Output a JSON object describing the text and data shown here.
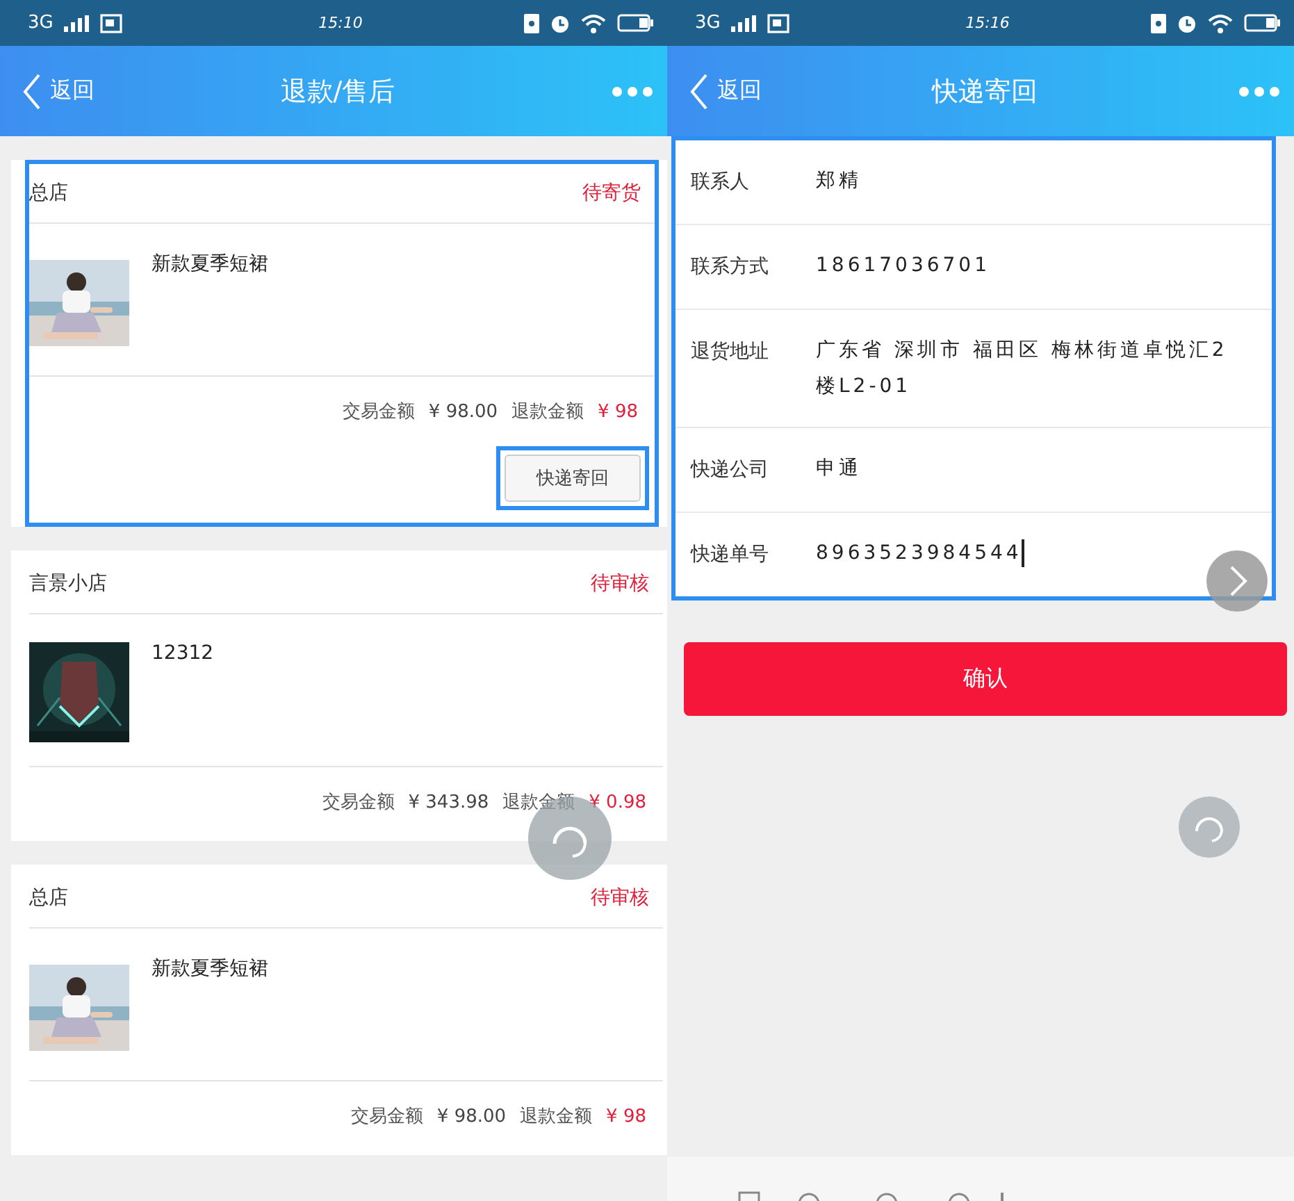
{
  "refund_list": {
    "status_bar": {
      "network": "3G",
      "time": "15:10"
    },
    "nav": {
      "back": "返回",
      "title": "退款/售后"
    },
    "orders": [
      {
        "shop": "总店",
        "status": "待寄货",
        "highlighted": true,
        "product": {
          "title": "新款夏季短裙",
          "kind": "picture"
        },
        "trade_label": "交易金额",
        "trade_amount": "¥ 98.00",
        "refund_label": "退款金额",
        "refund_amount": "¥ 98",
        "action": {
          "label": "快递寄回",
          "highlighted": true
        }
      },
      {
        "shop": "言景小店",
        "status": "待审核",
        "highlighted": false,
        "product": {
          "title": "12312",
          "kind": "picture"
        },
        "trade_label": "交易金额",
        "trade_amount": "¥ 343.98",
        "refund_label": "退款金额",
        "refund_amount": "¥ 0.98"
      },
      {
        "shop": "总店",
        "status": "待审核",
        "highlighted": false,
        "product": {
          "title": "新款夏季短裙",
          "kind": "picture"
        },
        "trade_label": "交易金额",
        "trade_amount": "¥ 98.00",
        "refund_label": "退款金额",
        "refund_amount": "¥ 98"
      }
    ]
  },
  "return_shipping": {
    "status_bar": {
      "network": "3G",
      "time": "15:16"
    },
    "nav": {
      "back": "返回",
      "title": "快递寄回"
    },
    "form_highlighted": true,
    "fields": [
      {
        "label": "联系人",
        "value": "郑精",
        "focused": false
      },
      {
        "label": "联系方式",
        "value": "18617036701",
        "focused": false
      },
      {
        "label": "退货地址",
        "value": "广东省 深圳市 福田区 梅林街道卓悦汇2楼L2-01",
        "focused": false
      },
      {
        "label": "快递公司",
        "value": "申通",
        "focused": false
      },
      {
        "label": "快递单号",
        "value": "8963523984544",
        "focused": true
      }
    ],
    "confirm": "确认"
  }
}
